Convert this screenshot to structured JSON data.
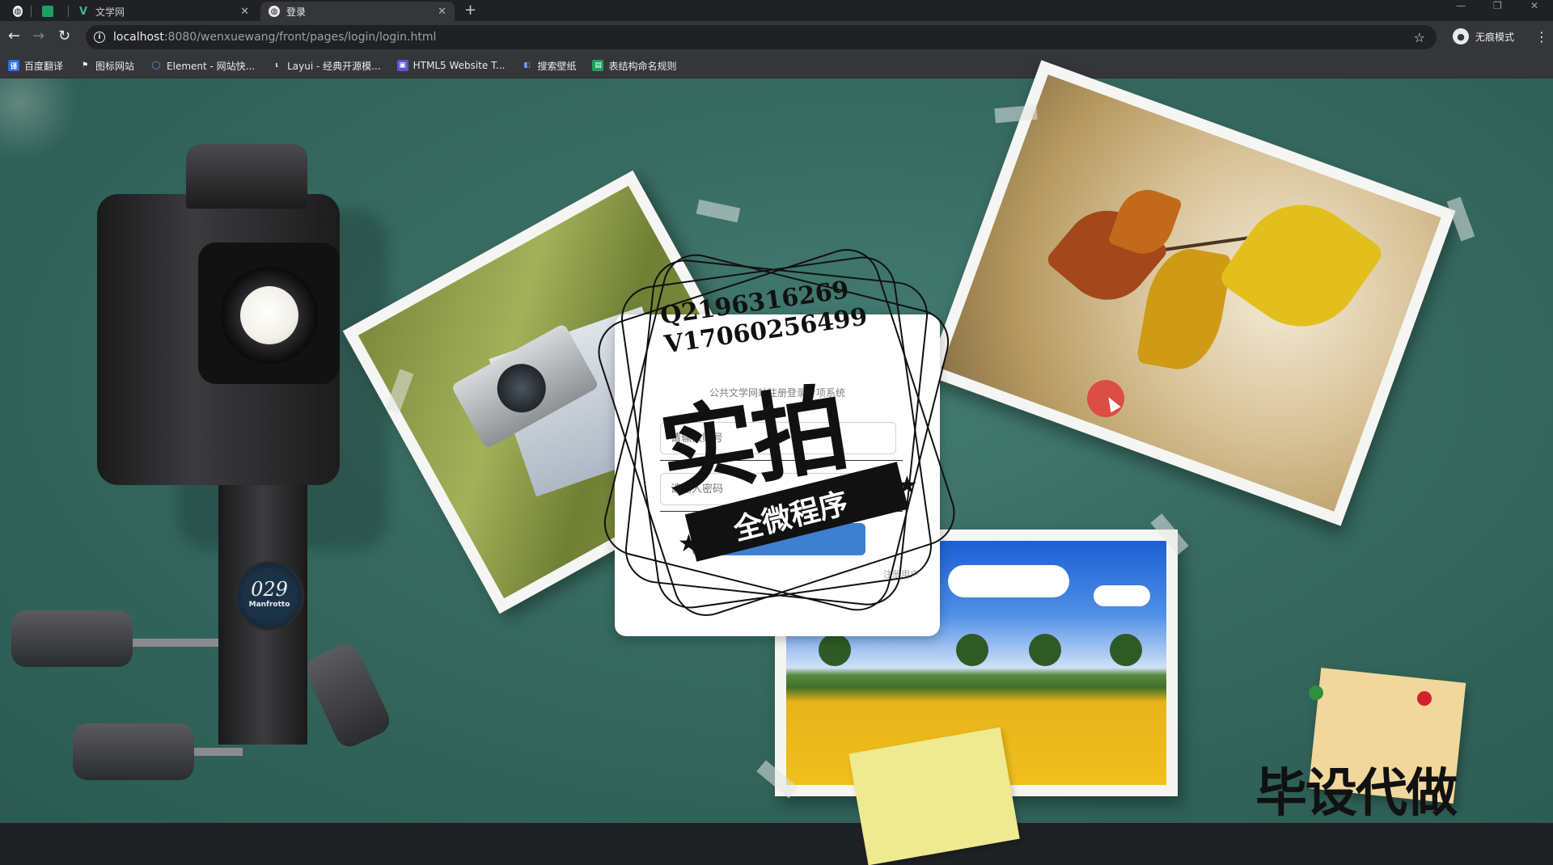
{
  "browser": {
    "tabs": [
      {
        "label": "",
        "favicon": "globe-icon"
      },
      {
        "label": "",
        "favicon": "sheet-icon"
      },
      {
        "label": "文学网",
        "favicon": "vue-icon"
      },
      {
        "label": "登录",
        "favicon": "globe-icon",
        "active": true
      }
    ],
    "new_tab": "+",
    "url_host": "localhost",
    "url_rest": ":8080/wenxuewang/front/pages/login/login.html",
    "incognito_label": "无痕模式",
    "bookmarks": [
      {
        "label": "百度翻译",
        "icon": "translate-icon",
        "color": "#2b6fde"
      },
      {
        "label": "图标网站",
        "icon": "flag-icon",
        "color": "#111111"
      },
      {
        "label": "Element - 网站快...",
        "icon": "element-icon",
        "color": "#4a90e2"
      },
      {
        "label": "Layui - 经典开源模...",
        "icon": "layui-icon",
        "color": "#555555"
      },
      {
        "label": "HTML5 Website T...",
        "icon": "html5-icon",
        "color": "#5a55d6"
      },
      {
        "label": "搜索壁纸",
        "icon": "wallpaper-icon",
        "color": "#3b6fd6"
      },
      {
        "label": "表结构命名规则",
        "icon": "sheet-icon",
        "color": "#1aa260"
      }
    ]
  },
  "login": {
    "title": "公共文学网站注册登录专项系统",
    "username_placeholder": "请输入账号",
    "password_placeholder": "请输入密码",
    "login_button": "",
    "register_link": "注册用户"
  },
  "watermark": {
    "qq": "Q2196316269",
    "v": "V17060256499",
    "big": "实拍",
    "sub": "全微程序",
    "corner": "毕设代做"
  },
  "colors": {
    "board": "#36695f",
    "button": "#3f7fd0"
  }
}
